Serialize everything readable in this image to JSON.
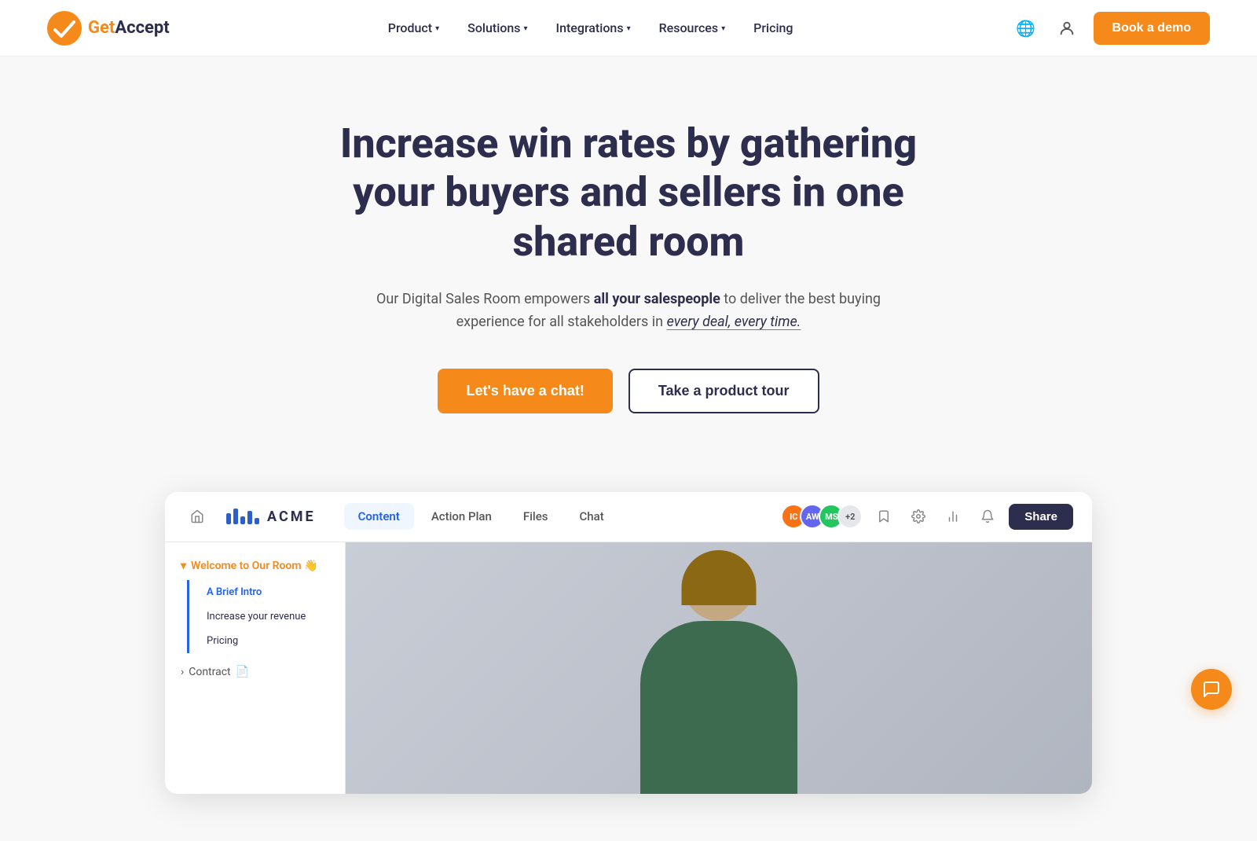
{
  "nav": {
    "logo_get": "Get",
    "logo_accept": "Accept",
    "links": [
      {
        "id": "product",
        "label": "Product",
        "has_dropdown": true
      },
      {
        "id": "solutions",
        "label": "Solutions",
        "has_dropdown": true
      },
      {
        "id": "integrations",
        "label": "Integrations",
        "has_dropdown": true
      },
      {
        "id": "resources",
        "label": "Resources",
        "has_dropdown": true
      },
      {
        "id": "pricing",
        "label": "Pricing",
        "has_dropdown": false
      }
    ],
    "book_demo_label": "Book a demo"
  },
  "hero": {
    "headline": "Increase win rates by gathering your buyers and sellers in one shared room",
    "subtext_part1": "Our Digital Sales Room empowers ",
    "subtext_bold": "all your salespeople",
    "subtext_part2": " to deliver the best buying experience for all stakeholders in ",
    "subtext_italic": "every deal, every time.",
    "btn_chat_label": "Let's have a chat!",
    "btn_tour_label": "Take a product tour"
  },
  "demo": {
    "home_icon": "🏠",
    "company_name": "ACME",
    "tabs": [
      {
        "id": "content",
        "label": "Content",
        "active": true
      },
      {
        "id": "action-plan",
        "label": "Action Plan",
        "active": false
      },
      {
        "id": "files",
        "label": "Files",
        "active": false
      },
      {
        "id": "chat",
        "label": "Chat",
        "active": false
      }
    ],
    "avatars": [
      {
        "id": "ic",
        "initials": "IC",
        "color": "#f97316"
      },
      {
        "id": "aw",
        "initials": "AW",
        "color": "#6366f1"
      },
      {
        "id": "ms",
        "initials": "MS",
        "color": "#22c55e"
      }
    ],
    "avatar_count": "+2",
    "share_label": "Share",
    "sidebar": {
      "section_label": "Welcome to Our Room 👋",
      "items": [
        {
          "id": "intro",
          "label": "A Brief Intro",
          "active": true
        },
        {
          "id": "revenue",
          "label": "Increase your revenue",
          "active": false
        },
        {
          "id": "pricing",
          "label": "Pricing",
          "active": false
        }
      ],
      "contract_label": "Contract",
      "contract_icon": "📄"
    }
  },
  "chat_bubble_icon": "💬"
}
